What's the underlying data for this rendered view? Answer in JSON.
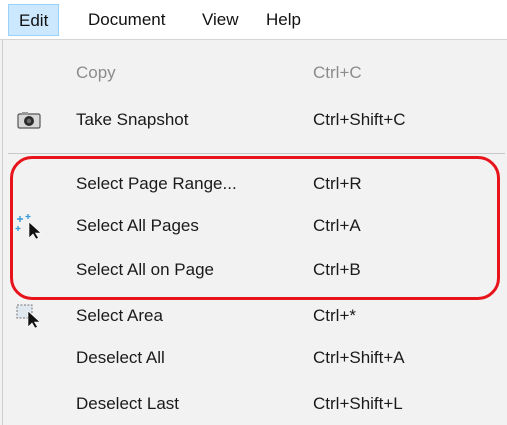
{
  "menubar": {
    "items": [
      {
        "label": "Edit"
      },
      {
        "label": "Document"
      },
      {
        "label": "View"
      },
      {
        "label": "Help"
      }
    ]
  },
  "edit_menu": {
    "items": [
      {
        "label": "Copy",
        "shortcut": "Ctrl+C",
        "enabled": false,
        "icon": ""
      },
      {
        "label": "Take Snapshot",
        "shortcut": "Ctrl+Shift+C",
        "enabled": true,
        "icon": "camera-icon"
      },
      {
        "label": "Select Page Range...",
        "shortcut": "Ctrl+R",
        "enabled": true,
        "icon": ""
      },
      {
        "label": "Select All Pages",
        "shortcut": "Ctrl+A",
        "enabled": true,
        "icon": "select-all-pages-icon"
      },
      {
        "label": "Select All on Page",
        "shortcut": "Ctrl+B",
        "enabled": true,
        "icon": ""
      },
      {
        "label": "Select Area",
        "shortcut": "Ctrl+*",
        "enabled": true,
        "icon": "select-area-icon"
      },
      {
        "label": "Deselect All",
        "shortcut": "Ctrl+Shift+A",
        "enabled": true,
        "icon": ""
      },
      {
        "label": "Deselect Last",
        "shortcut": "Ctrl+Shift+L",
        "enabled": true,
        "icon": ""
      }
    ]
  },
  "colors": {
    "active_menu_bg": "#cce8ff",
    "active_menu_border": "#99d1ff",
    "annotation": "#e8141c",
    "disabled_text": "#8c8c8c"
  }
}
